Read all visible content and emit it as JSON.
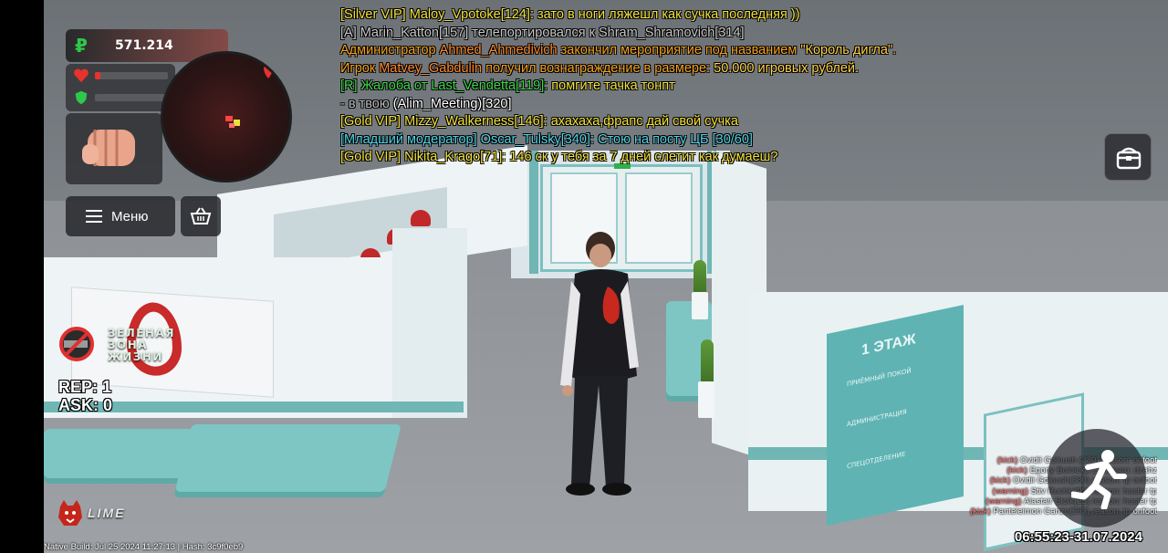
{
  "hud": {
    "money": "571.214",
    "health_fraction": 0.08,
    "armor_fraction": 0.0,
    "green_zone_text": "ЗЕЛЕНАЯ\nЗОНА\nЖИЗНИ",
    "rep_text": "REP: 1",
    "ask_text": "ASK: 0",
    "menu_label": "Меню",
    "clock": "06:55:23-31.07.2024",
    "build_info": "Native Build: Jul 25 2024 11:27:13 | Hash: 3c9f0eb9",
    "server_name": "LIME",
    "colors": {
      "money": "#2ec84a",
      "health": "#e8322c",
      "armor": "#2ec84a",
      "accent": "#d9362a"
    }
  },
  "chat": [
    {
      "color": "#f4e23a",
      "segments": [
        {
          "text": "[Silver VIP] Maloy_Vpotoke[124]: зато в ноги ляжешл как сучка последняя ))"
        }
      ]
    },
    {
      "color": "#c8c8c8",
      "segments": [
        {
          "text": "[A] Marin_Katton[157] телепортировался к Shram_Shramovich[314]"
        }
      ]
    },
    {
      "color": "#f4a21f",
      "segments": [
        {
          "text": "Администратор ",
          "color": "#f4a21f"
        },
        {
          "text": "Ahmed_Ahmedivich",
          "color": "#ff8a2a"
        },
        {
          "text": " закончил мероприятие под названием ",
          "color": "#f4a21f"
        },
        {
          "text": "\"Король дигла\"",
          "color": "#ffd24a"
        },
        {
          "text": ".",
          "color": "#f4a21f"
        }
      ]
    },
    {
      "color": "#f4a21f",
      "segments": [
        {
          "text": "Игрок ",
          "color": "#f4a21f"
        },
        {
          "text": "Matvey_Gabdulin",
          "color": "#ff8a2a"
        },
        {
          "text": " получил вознаграждение в размере: ",
          "color": "#f4a21f"
        },
        {
          "text": "50.000 игровых рублей.",
          "color": "#ffd24a"
        }
      ]
    },
    {
      "color": "#9cf54a",
      "segments": [
        {
          "text": "[R] Жалоба от Last_Vendetta[119]: ",
          "color": "#3fd84a"
        },
        {
          "text": "помгите тачка тонпт",
          "color": "#f4e23a"
        }
      ]
    },
    {
      "color": "#ffffff",
      "segments": [
        {
          "text": "- в твою ",
          "color": "#bdbdbd"
        },
        {
          "text": "(Alim_Meeting)[320]",
          "color": "#ffffff"
        }
      ]
    },
    {
      "color": "#f4e23a",
      "segments": [
        {
          "text": "[Gold VIP] Mizzy_Walkerness[146]: ахахаха,фрапс дай свой сучка"
        }
      ]
    },
    {
      "color": "#4fd4e8",
      "segments": [
        {
          "text": "[Младший модератор] Oscar_Tulsky[340]: Стою на посту ЦБ [30/60]"
        }
      ]
    },
    {
      "color": "#f4e23a",
      "segments": [
        {
          "text": "[Gold VIP] Nikita_Krago[71]: 146 ск у тебя за 7 дней слетит как думаеш?"
        }
      ]
    }
  ],
  "kick_log": [
    {
      "tag": "(kick)",
      "text": " Ovidii Goloush   (380)   reason:   onfoot"
    },
    {
      "tag": "(kick)",
      "text": " Egoriy Bolnick(71)   reason:   dzahz"
    },
    {
      "tag": "(kick)",
      "text": " Ovidii Goloush(380)   reason:   tp onfoot"
    },
    {
      "tag": "(warning)",
      "text": " Stiv Ruchki(92)   reason:   hoster tp"
    },
    {
      "tag": "(warning)",
      "text": " Alastair Stolk(25)   reason:   hoster tp"
    },
    {
      "tag": "(kick)",
      "text": " Panteleimon Ganzo(363)   reason:   tp onfoot"
    }
  ],
  "scene_text": {
    "floor_sign_title": "1 ЭТАЖ",
    "floor_sign_lines": [
      "ПРИЁМНЫЙ ПОКОЙ",
      "АДМИНИСТРАЦИЯ",
      "СПЕЦОТДЕЛЕНИЕ"
    ]
  },
  "icons": {
    "money": "ruble-icon",
    "health": "heart-icon",
    "armor": "shield-icon",
    "fist": "fist-icon",
    "menu": "hamburger-icon",
    "shop": "basket-icon",
    "inventory": "chest-icon",
    "sprint": "running-man-icon",
    "logo": "bear-logo-icon"
  }
}
